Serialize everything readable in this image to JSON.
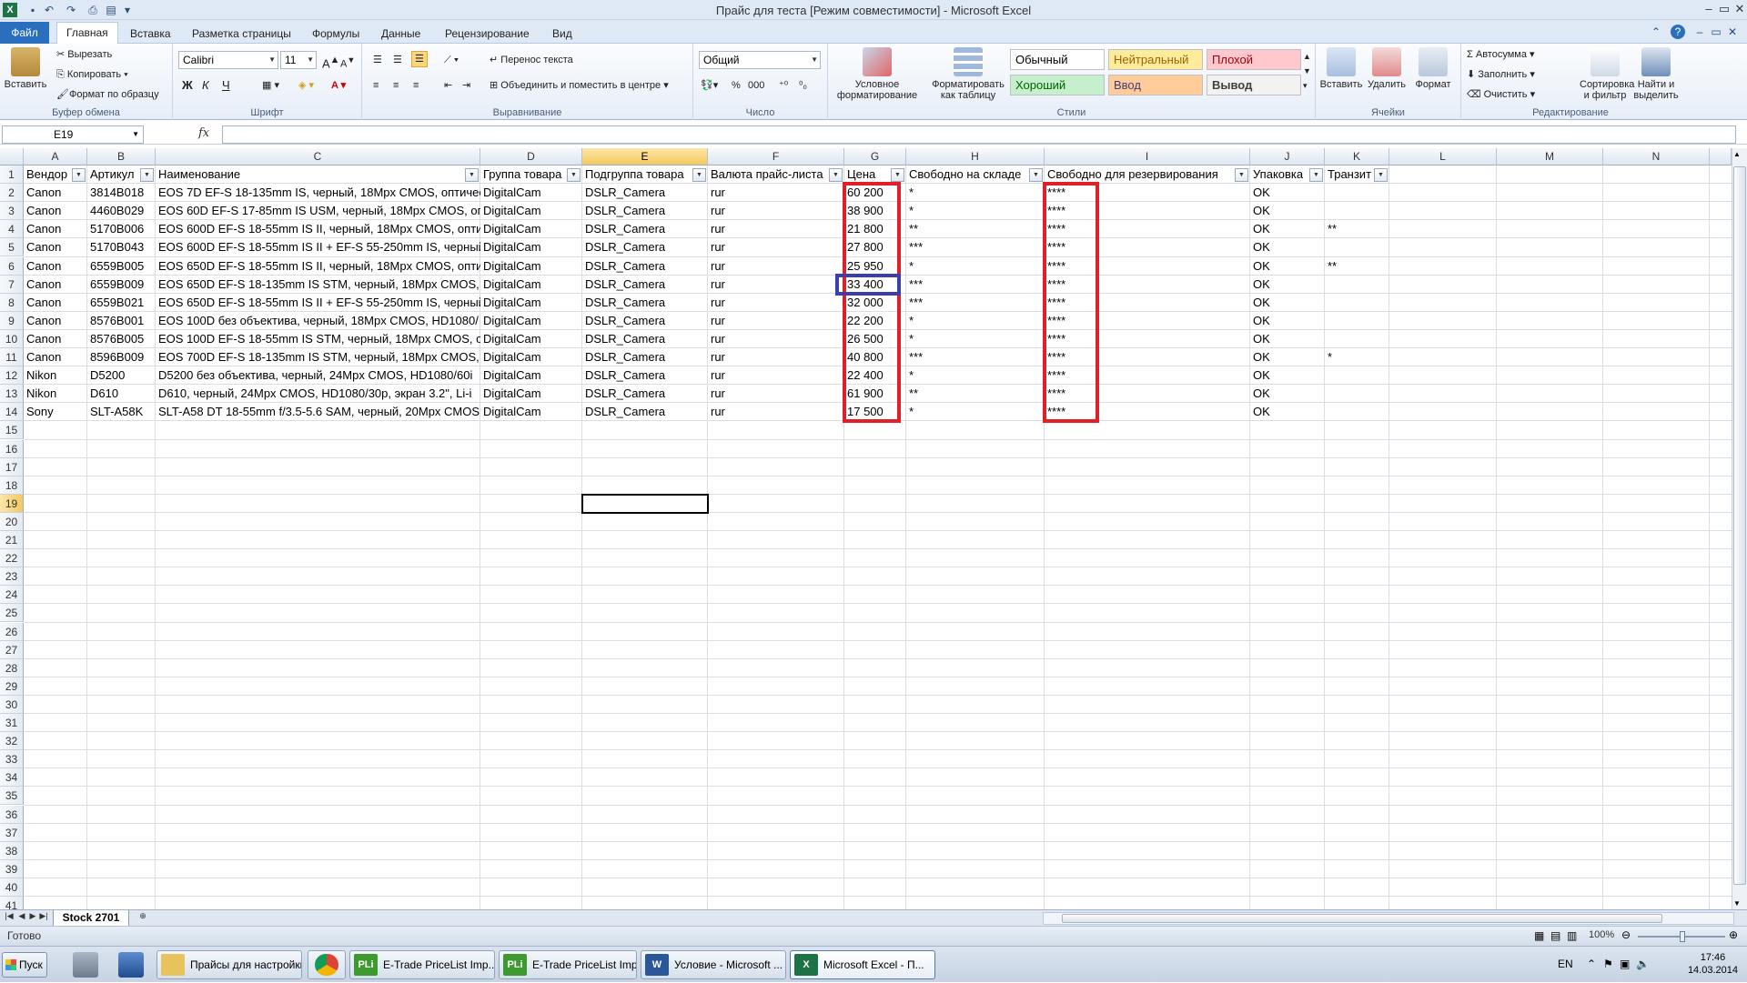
{
  "window": {
    "title": "Прайс для теста  [Режим совместимости]  -  Microsoft Excel",
    "app_icon": "X",
    "qat": [
      "save-icon",
      "undo-icon",
      "redo-icon",
      "print-preview-icon",
      "quick-print-icon",
      "customize-icon"
    ],
    "buttons": [
      "minimize-icon",
      "maximize-icon",
      "close-icon"
    ]
  },
  "ribbon_tabs": {
    "file": "Файл",
    "tabs": [
      "Главная",
      "Вставка",
      "Разметка страницы",
      "Формулы",
      "Данные",
      "Рецензирование",
      "Вид"
    ],
    "active": "Главная"
  },
  "ribbon": {
    "clipboard": {
      "label": "Буфер обмена",
      "paste": "Вставить",
      "cut": "Вырезать",
      "copy": "Копировать",
      "format_painter": "Формат по образцу"
    },
    "font": {
      "label": "Шрифт",
      "name": "Calibri",
      "size": "11",
      "bold": "Ж",
      "italic": "К",
      "underline": "Ч"
    },
    "alignment": {
      "label": "Выравнивание",
      "wrap": "Перенос текста",
      "merge": "Объединить и поместить в центре"
    },
    "number": {
      "label": "Число",
      "format": "Общий",
      "percent": "%",
      "thousands": "000"
    },
    "styles": {
      "label": "Стили",
      "conditional": "Условное форматирование",
      "as_table": "Форматировать как таблицу",
      "cells": [
        {
          "name": "Обычный",
          "bg": "#ffffff",
          "fg": "#000000"
        },
        {
          "name": "Нейтральный",
          "bg": "#ffeb9c",
          "fg": "#9c6500"
        },
        {
          "name": "Плохой",
          "bg": "#ffc7ce",
          "fg": "#9c0006"
        },
        {
          "name": "Хороший",
          "bg": "#c6efce",
          "fg": "#006100"
        },
        {
          "name": "Ввод",
          "bg": "#ffcc99",
          "fg": "#3f3f76"
        },
        {
          "name": "Вывод",
          "bg": "#f2f2f2",
          "fg": "#3f3f3f"
        }
      ]
    },
    "cells": {
      "label": "Ячейки",
      "insert": "Вставить",
      "delete": "Удалить",
      "format": "Формат"
    },
    "editing": {
      "label": "Редактирование",
      "autosum": "Автосумма",
      "fill": "Заполнить",
      "clear": "Очистить",
      "sort": "Сортировка и фильтр",
      "find": "Найти и выделить"
    }
  },
  "formula_bar": {
    "name_box": "E19",
    "fx": "fx",
    "value": ""
  },
  "sheet": {
    "columns": [
      "A",
      "B",
      "C",
      "D",
      "E",
      "F",
      "G",
      "H",
      "I",
      "J",
      "K",
      "L",
      "M",
      "N"
    ],
    "selected_column": "E",
    "selected_row": 19,
    "row_count": 41,
    "headers": [
      "Вендор",
      "Артикул",
      "Наименование",
      "Группа товара",
      "Подгруппа товара",
      "Валюта прайс-листа",
      "Цена",
      "Свободно на складе",
      "Свободно для резервирования",
      "Упаковка",
      "Транзит"
    ],
    "rows": [
      [
        "Canon",
        "3814B018",
        "EOS 7D EF-S 18-135mm IS, черный, 18Mpx CMOS, оптичес",
        "DigitalCam",
        "DSLR_Camera",
        "rur",
        "60 200",
        "*",
        "****",
        "OK",
        ""
      ],
      [
        "Canon",
        "4460B029",
        "EOS 60D EF-S 17-85mm IS USM, черный, 18Mpx CMOS, опт",
        "DigitalCam",
        "DSLR_Camera",
        "rur",
        "38 900",
        "*",
        "****",
        "OK",
        ""
      ],
      [
        "Canon",
        "5170B006",
        "EOS 600D EF-S 18-55mm IS II, черный, 18Mpx CMOS, опти",
        "DigitalCam",
        "DSLR_Camera",
        "rur",
        "21 800",
        "**",
        "****",
        "OK",
        "**"
      ],
      [
        "Canon",
        "5170B043",
        "EOS 600D EF-S 18-55mm IS II + EF-S 55-250mm IS, черный,",
        "DigitalCam",
        "DSLR_Camera",
        "rur",
        "27 800",
        "***",
        "****",
        "OK",
        ""
      ],
      [
        "Canon",
        "6559B005",
        "EOS 650D EF-S 18-55mm IS II, черный, 18Mpx CMOS, опти",
        "DigitalCam",
        "DSLR_Camera",
        "rur",
        "25 950",
        "*",
        "****",
        "OK",
        "**"
      ],
      [
        "Canon",
        "6559B009",
        "EOS 650D EF-S 18-135mm IS STM, черный, 18Mpx CMOS, о",
        "DigitalCam",
        "DSLR_Camera",
        "rur",
        "33 400",
        "***",
        "****",
        "OK",
        ""
      ],
      [
        "Canon",
        "6559B021",
        "EOS 650D EF-S 18-55mm IS II + EF-S 55-250mm IS, черный,",
        "DigitalCam",
        "DSLR_Camera",
        "rur",
        "32 000",
        "***",
        "****",
        "OK",
        ""
      ],
      [
        "Canon",
        "8576B001",
        "EOS 100D без объектива, черный, 18Mpx CMOS, HD1080/",
        "DigitalCam",
        "DSLR_Camera",
        "rur",
        "22 200",
        "*",
        "****",
        "OK",
        ""
      ],
      [
        "Canon",
        "8576B005",
        "EOS 100D EF-S 18-55mm IS STM, черный, 18Mpx CMOS, оп",
        "DigitalCam",
        "DSLR_Camera",
        "rur",
        "26 500",
        "*",
        "****",
        "OK",
        ""
      ],
      [
        "Canon",
        "8596B009",
        "EOS 700D EF-S 18-135mm IS STM, черный, 18Mpx CMOS, о",
        "DigitalCam",
        "DSLR_Camera",
        "rur",
        "40 800",
        "***",
        "****",
        "OK",
        "*"
      ],
      [
        "Nikon",
        "D5200",
        "D5200 без объектива, черный, 24Mpx CMOS, HD1080/60i",
        "DigitalCam",
        "DSLR_Camera",
        "rur",
        "22 400",
        "*",
        "****",
        "OK",
        ""
      ],
      [
        "Nikon",
        "D610",
        "D610, черный, 24Mpx CMOS, HD1080/30p, экран 3.2\", Li-i",
        "DigitalCam",
        "DSLR_Camera",
        "rur",
        "61 900",
        "**",
        "****",
        "OK",
        ""
      ],
      [
        "Sony",
        "SLT-A58K",
        "SLT-A58 DT 18-55mm f/3.5-5.6 SAM, черный, 20Mpx CMOS",
        "DigitalCam",
        "DSLR_Camera",
        "rur",
        "17 500",
        "*",
        "****",
        "OK",
        ""
      ]
    ],
    "tab_name": "Stock 2701"
  },
  "status": {
    "ready": "Готово",
    "zoom": "100%"
  },
  "taskbar": {
    "start": "Пуск",
    "items": [
      {
        "label": "Прайсы для настройки",
        "icon": "folder-icon",
        "color": "#e8c25a"
      },
      {
        "label": "E-Trade PriceList Imp...",
        "icon": "pli-icon",
        "color": "#3d9a2f"
      },
      {
        "label": "E-Trade PriceList Imp...",
        "icon": "pli-icon",
        "color": "#3d9a2f"
      },
      {
        "label": "Условие - Microsoft ...",
        "icon": "word-icon",
        "color": "#2b579a"
      },
      {
        "label": "Microsoft Excel - П...",
        "icon": "excel-icon",
        "color": "#1d7345"
      }
    ],
    "lang": "EN",
    "time": "17:46",
    "date": "14.03.2014"
  },
  "colors": {
    "highlight_red": "#e21f26",
    "highlight_blue": "#3b3fae",
    "accent": "#2a6fbd"
  }
}
